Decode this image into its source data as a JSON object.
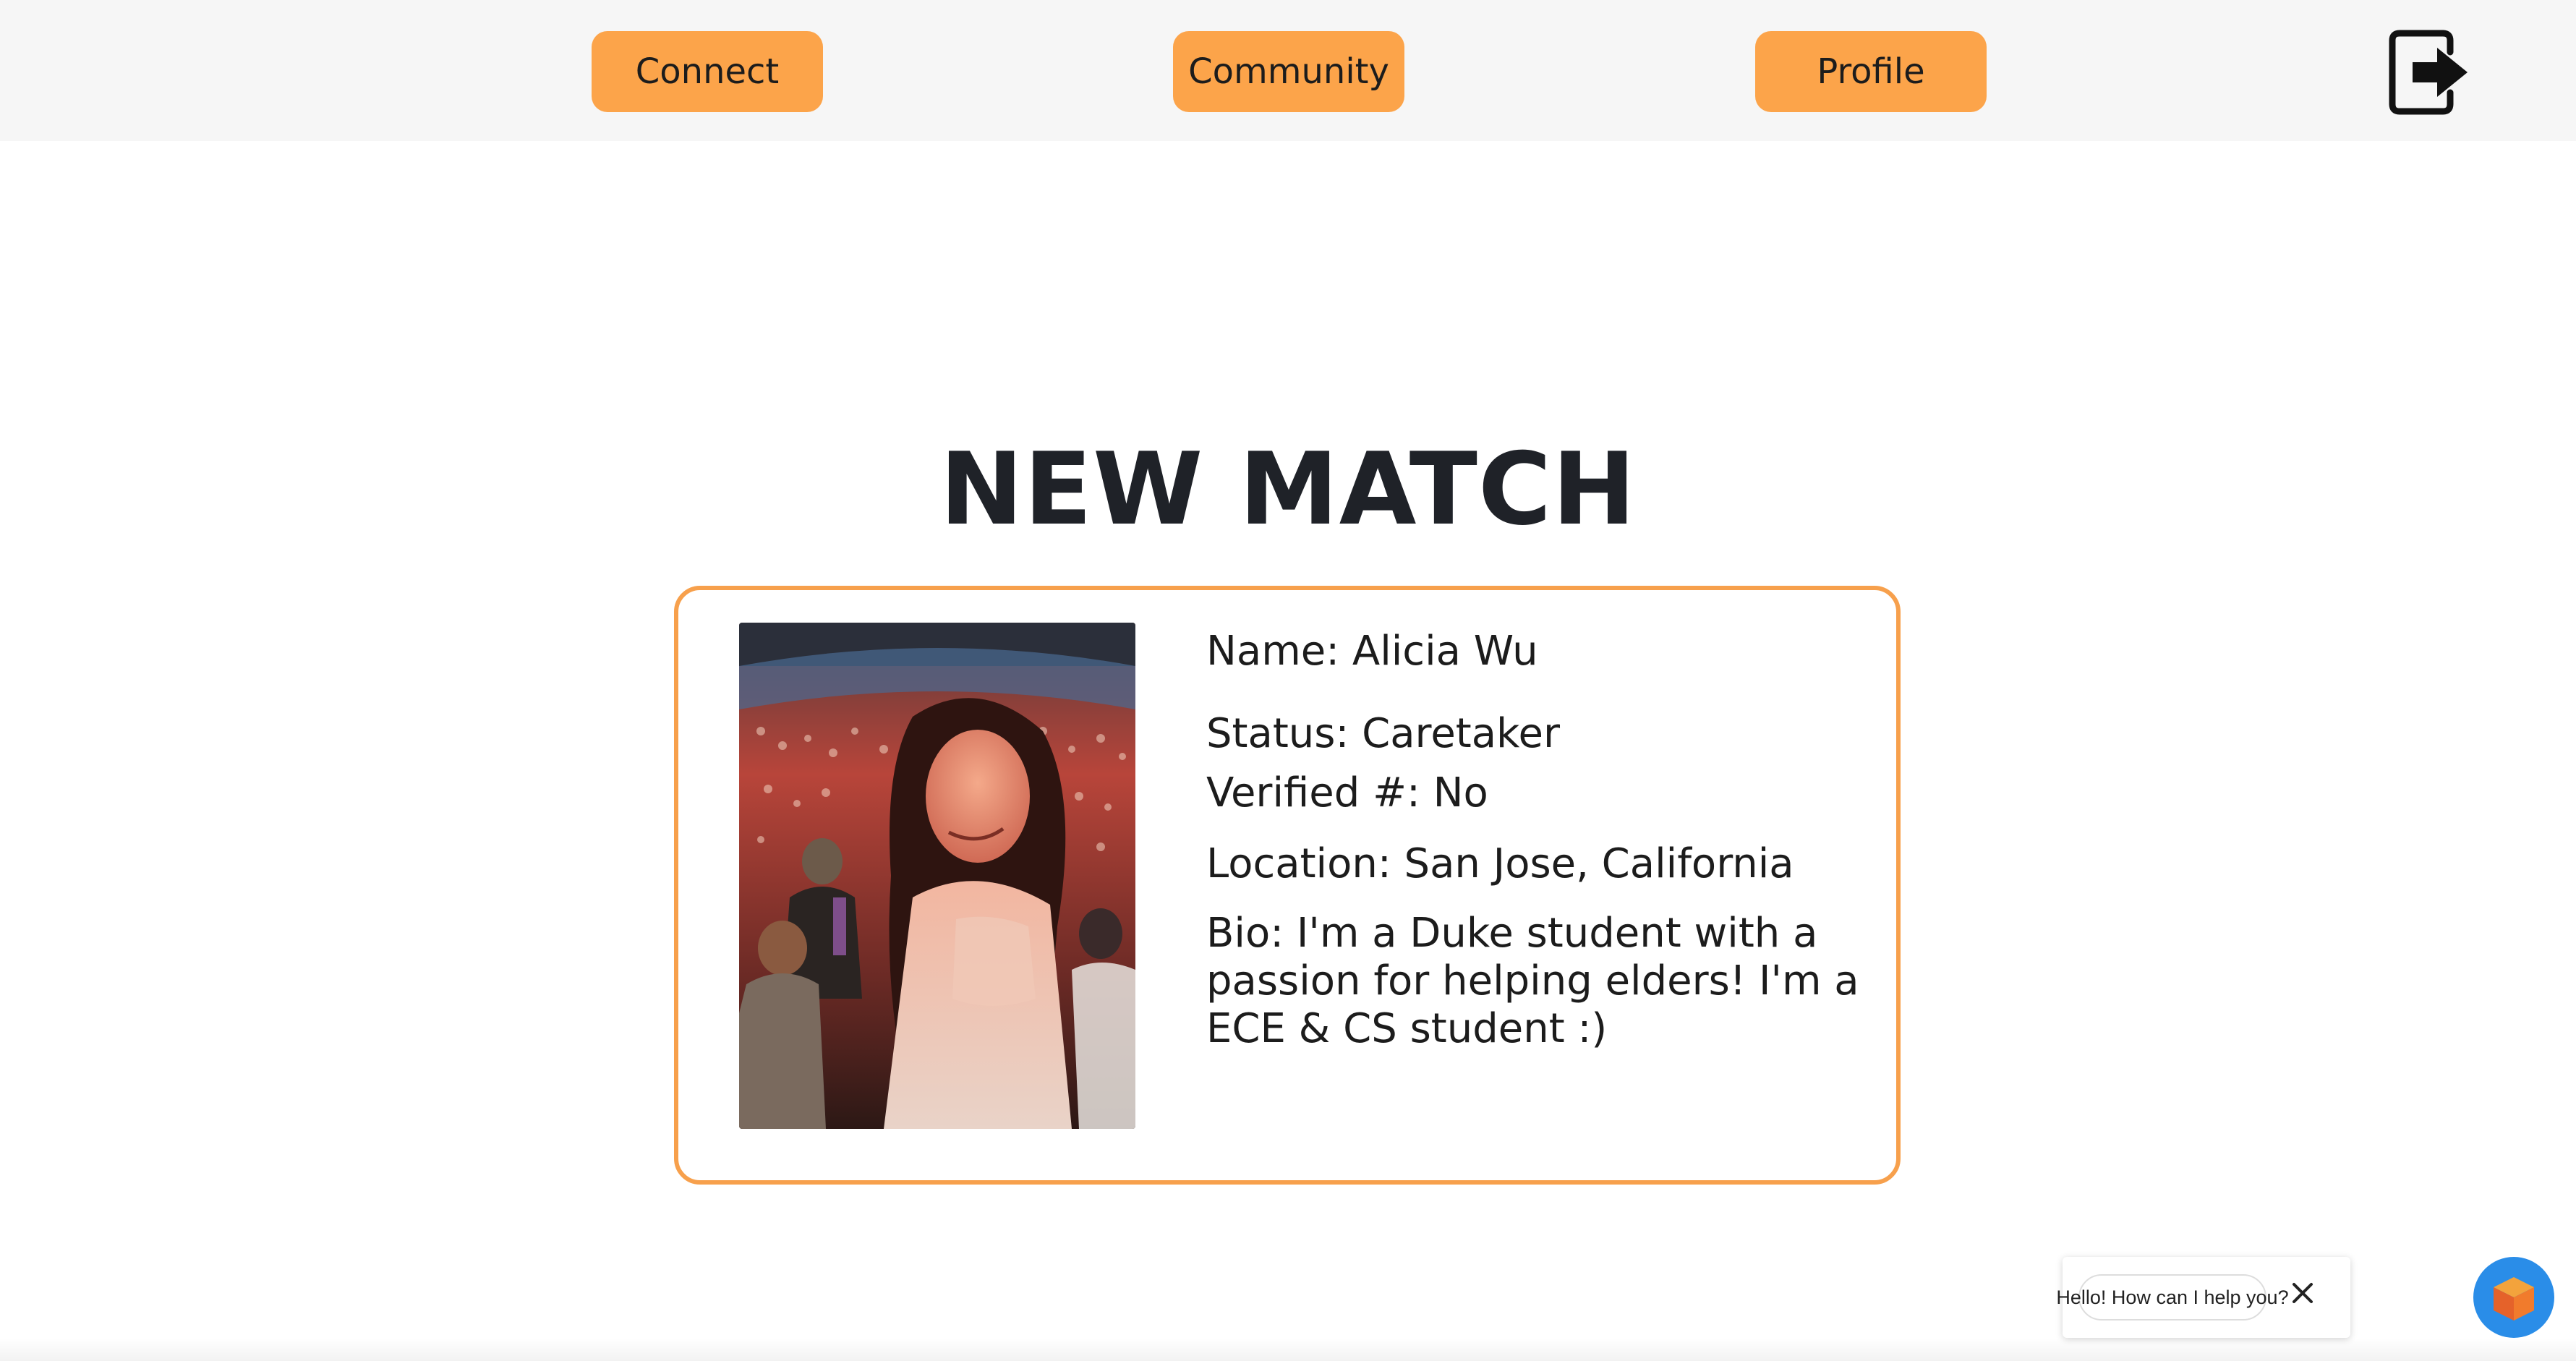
{
  "nav": {
    "connect_label": "Connect",
    "community_label": "Community",
    "profile_label": "Profile",
    "logout_icon": "logout-icon",
    "accent_color": "#fca44a"
  },
  "heading": "NEW MATCH",
  "match": {
    "photo_icon": "profile-photo",
    "name": "Name: Alicia Wu",
    "status": "Status: Caretaker",
    "verified": "Verified #: No",
    "location": "Location: San Jose, California",
    "bio": "Bio: I'm a Duke student with a passion for helping elders! I'm a ECE & CS student :)",
    "border_color": "#f7a04c"
  },
  "chat": {
    "greeting": "Hello! How can I help you?",
    "close_icon": "close-icon",
    "launcher_icon": "chat-cube-icon"
  }
}
